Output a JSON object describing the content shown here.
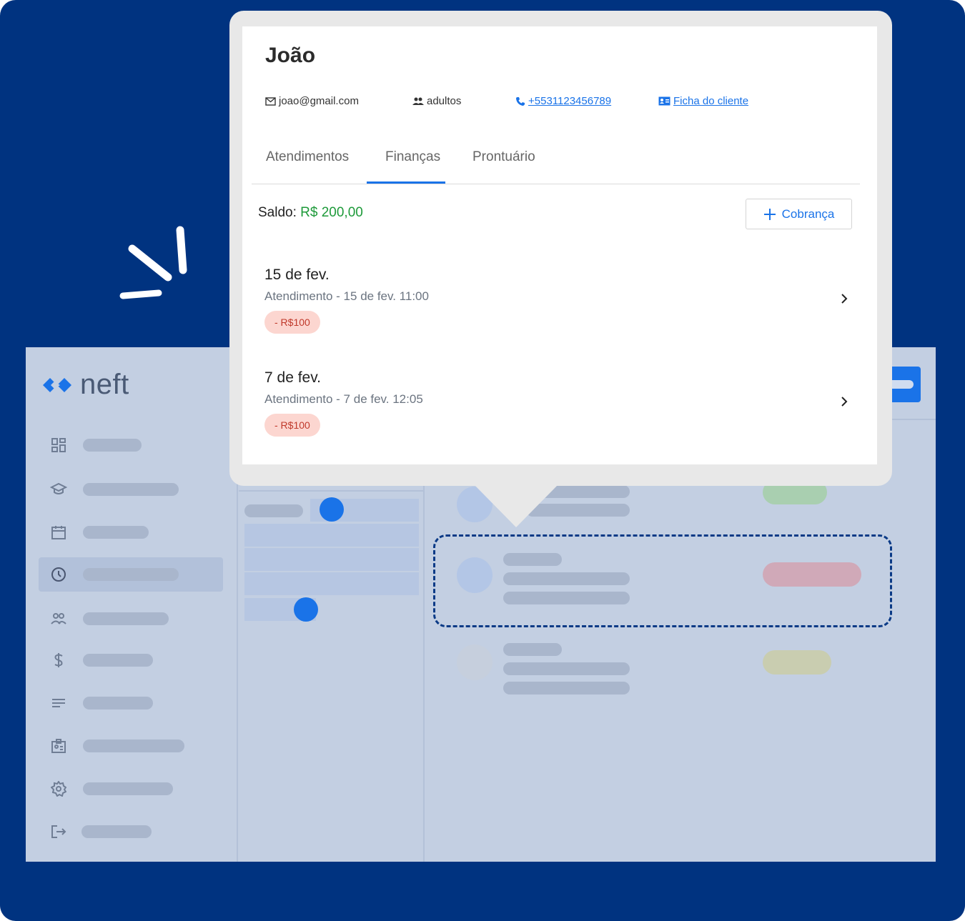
{
  "background_app": {
    "brand": "neft",
    "colors": {
      "accent": "#1a73e8",
      "frame_bg": "#003380"
    },
    "nav_icons": [
      "dashboard-icon",
      "graduation-cap-icon",
      "calendar-icon",
      "clock-icon",
      "users-icon",
      "dollar-icon",
      "notes-icon",
      "id-badge-icon",
      "gear-icon",
      "logout-icon"
    ],
    "active_nav_index": 3
  },
  "client": {
    "name": "João",
    "email": "joao@gmail.com",
    "group": "adultos",
    "phone": "+5531123456789",
    "profile_link": "Ficha do cliente"
  },
  "tabs": [
    {
      "label": "Atendimentos",
      "active": false
    },
    {
      "label": "Finanças",
      "active": true
    },
    {
      "label": "Prontuário",
      "active": false
    }
  ],
  "finance": {
    "saldo_label": "Saldo:",
    "saldo_value": "R$ 200,00",
    "charge_button": "Cobrança",
    "entries": [
      {
        "title": "15 de fev.",
        "subtitle": "Atendimento - 15 de fev. 11:00",
        "amount": "- R$100"
      },
      {
        "title": "7 de fev.",
        "subtitle": "Atendimento - 7 de fev. 12:05",
        "amount": "- R$100"
      }
    ]
  }
}
